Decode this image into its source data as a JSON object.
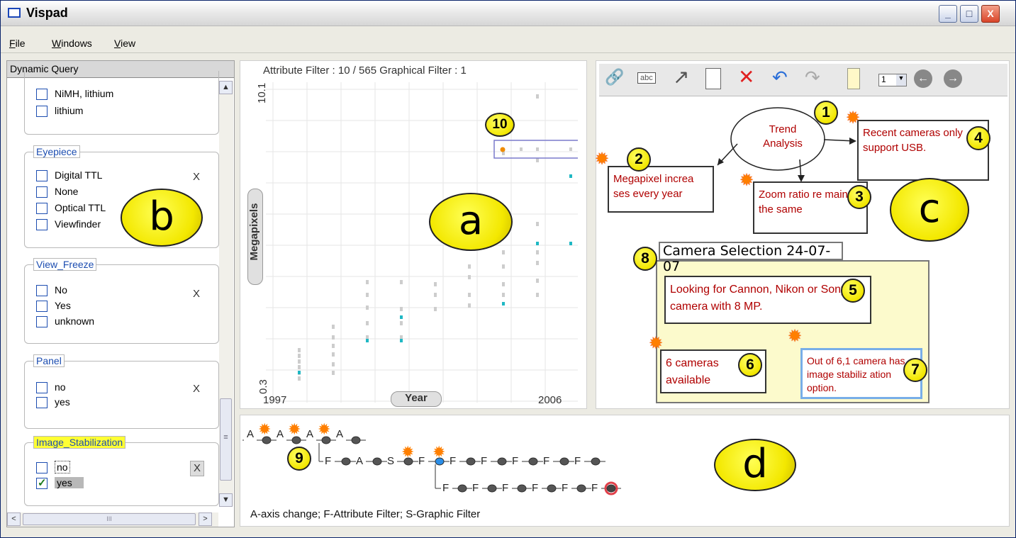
{
  "window": {
    "title": "Vispad",
    "minimize": "_",
    "maximize": "□",
    "close": "X"
  },
  "menu": [
    "File",
    "Windows",
    "View"
  ],
  "left_panel": {
    "header": "Dynamic Query",
    "clipped_group": {
      "items": [
        "NiMH, lithium",
        "lithium"
      ]
    },
    "groups": [
      {
        "name": "Eyepiece",
        "clear": "X",
        "items": [
          "Digital TTL",
          "None",
          "Optical TTL",
          "Viewfinder"
        ]
      },
      {
        "name": "View_Freeze",
        "clear": "X",
        "items": [
          "No",
          "Yes",
          "unknown"
        ]
      },
      {
        "name": "Panel",
        "clear": "X",
        "items": [
          "no",
          "yes"
        ]
      },
      {
        "name": "Image_Stabilization",
        "clear": "X",
        "items": [
          "no",
          "yes"
        ],
        "checked": "yes",
        "highlighted": true
      }
    ],
    "scroll_up": "▲",
    "scroll_down": "▼",
    "scroll_left": "<",
    "scroll_right": ">",
    "thumb_grip": "≡",
    "hthumb_grip": "III"
  },
  "plot": {
    "title": "Attribute Filter : 10 / 565 Graphical Filter : 1",
    "y_axis_label": "Megapixels",
    "y_max_label": "10.1",
    "y_min_label": "0.3",
    "x_axis_label": "Year",
    "x_min_label": "1997",
    "x_max_label": "2006",
    "selection_close": "×",
    "colors": {
      "highlight": "#1fb8c4",
      "selected": "#f08c00",
      "other": "#c8c8c8",
      "selection_box": "#7a7acc"
    }
  },
  "notes": {
    "toolbar": {
      "page_value": "1"
    },
    "trend": "Trend Analysis",
    "n2": "Megapixel increa ses every year",
    "n3": "Zoom ratio re mains the same",
    "n4": "Recent cameras only support USB.",
    "frame_title": "Camera Selection 24-07-07",
    "n5": "Looking for Cannon, Nikon or Sony camera with 8 MP.",
    "n6": "6 cameras available",
    "n7": "Out of 6,1 camera has image stabiliz ation option.",
    "text_color": "#b00000"
  },
  "history": {
    "legend": "A-axis change; F-Attribute Filter; S-Graphic Filter",
    "row1": [
      "A",
      "A",
      "A",
      "A"
    ],
    "row2": [
      "F",
      "A",
      "S",
      "F",
      "F",
      "F",
      "F",
      "F",
      "F"
    ],
    "row3": [
      "F",
      "F",
      "F",
      "F",
      "F",
      "F"
    ]
  },
  "badges": {
    "a": "a",
    "b": "b",
    "c": "c",
    "d": "d",
    "n1": "1",
    "n2": "2",
    "n3": "3",
    "n4": "4",
    "n5": "5",
    "n6": "6",
    "n7": "7",
    "n8": "8",
    "n9": "9",
    "n10": "10"
  }
}
